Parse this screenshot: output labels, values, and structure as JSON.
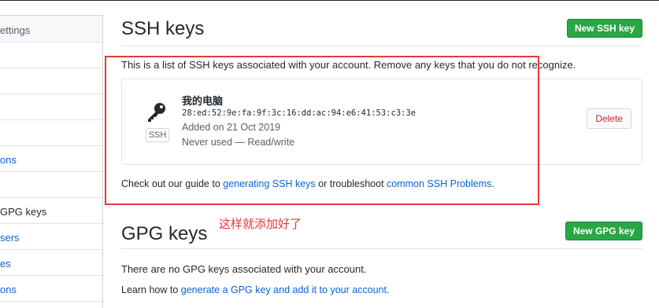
{
  "sidebar": {
    "header": "ettings",
    "items": [
      {
        "label": ""
      },
      {
        "label": ""
      },
      {
        "label": ""
      },
      {
        "label": ""
      },
      {
        "label": "ons"
      },
      {
        "label": ""
      },
      {
        "label": "GPG keys"
      },
      {
        "label": "sers"
      },
      {
        "label": "es"
      },
      {
        "label": "ons"
      }
    ]
  },
  "ssh": {
    "title": "SSH keys",
    "new_button": "New SSH key",
    "description": "This is a list of SSH keys associated with your account. Remove any keys that you do not recognize.",
    "key": {
      "name": "我的电脑",
      "fingerprint": "28:ed:52:9e:fa:9f:3c:16:dd:ac:94:e6:41:53:c3:3e",
      "added": "Added on 21 Oct 2019",
      "usage": "Never used — Read/write",
      "badge": "SSH",
      "delete_button": "Delete"
    },
    "guide_prefix": "Check out our guide to ",
    "guide_link1": "generating SSH keys",
    "guide_middle": " or troubleshoot ",
    "guide_link2": "common SSH Problems",
    "guide_suffix": "."
  },
  "annotation": "这样就添加好了",
  "gpg": {
    "title": "GPG keys",
    "new_button": "New GPG key",
    "empty": "There are no GPG keys associated with your account.",
    "learn_prefix": "Learn how to ",
    "learn_link": "generate a GPG key and add it to your account",
    "learn_suffix": "."
  },
  "colors": {
    "accent_green": "#28a745",
    "link_blue": "#0366d6",
    "annotation_red": "#e53935",
    "delete_red": "#cb2431"
  }
}
